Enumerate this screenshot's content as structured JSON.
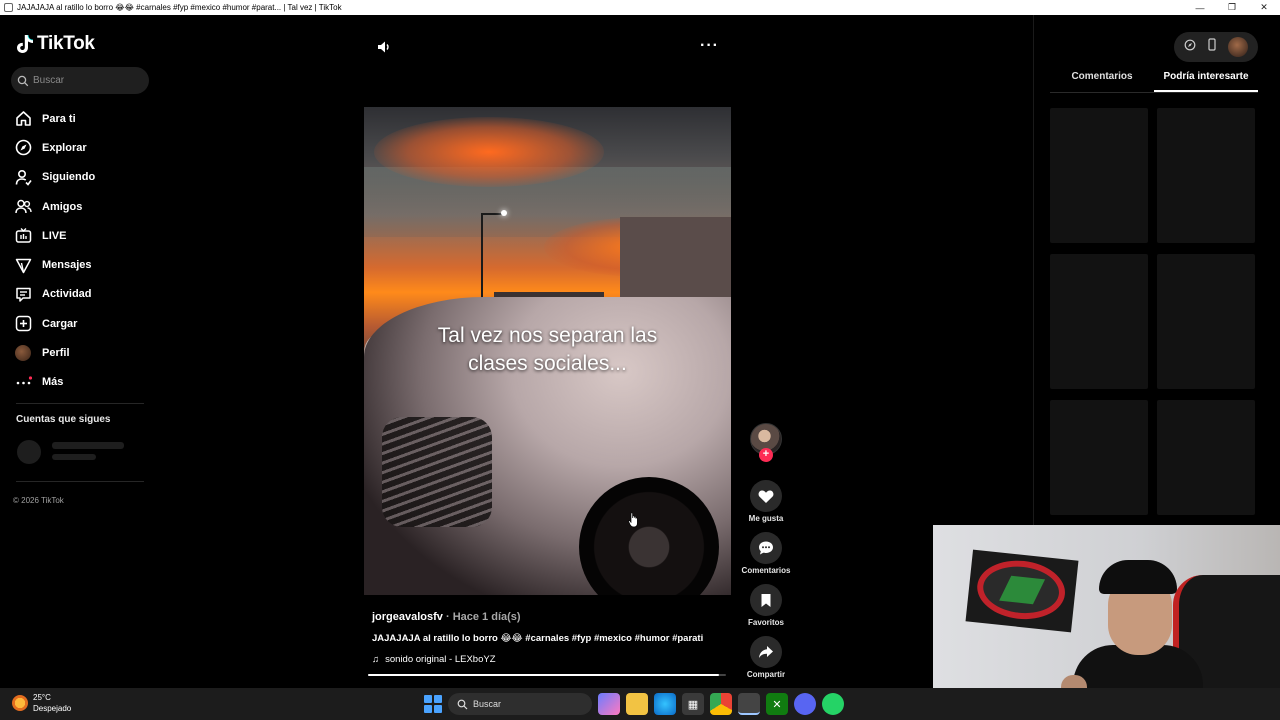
{
  "window": {
    "title": "JAJAJAJA al ratillo lo borro 😂😂 #carnales #fyp #mexico #humor #parat... | Tal vez | TikTok"
  },
  "sidebar": {
    "logo": "TikTok",
    "search_placeholder": "Buscar",
    "items": [
      {
        "label": "Para ti",
        "icon": "home-icon"
      },
      {
        "label": "Explorar",
        "icon": "compass-icon"
      },
      {
        "label": "Siguiendo",
        "icon": "user-follow-icon"
      },
      {
        "label": "Amigos",
        "icon": "friends-icon"
      },
      {
        "label": "LIVE",
        "icon": "live-tv-icon"
      },
      {
        "label": "Mensajes",
        "icon": "send-icon"
      },
      {
        "label": "Actividad",
        "icon": "activity-icon"
      },
      {
        "label": "Cargar",
        "icon": "upload-plus-icon"
      },
      {
        "label": "Perfil",
        "icon": "avatar-icon"
      },
      {
        "label": "Más",
        "icon": "more-dots-icon"
      }
    ],
    "following_title": "Cuentas que sigues",
    "copyright": "© 2026 TikTok"
  },
  "video": {
    "caption_line1": "Tal vez nos separan las",
    "caption_line2": "clases sociales...",
    "username": "jorgeavalosfv",
    "time_ago": "· Hace 1 día(s)",
    "description": "JAJAJAJA al ratillo lo borro 😂😂 #carnales #fyp #mexico #humor #parati",
    "sound": "sonido original - LEXboYZ",
    "progress": 0.98
  },
  "actions": {
    "like": "Me gusta",
    "comments": "Comentarios",
    "favorites": "Favoritos",
    "share": "Compartir"
  },
  "right_panel": {
    "tabs": [
      {
        "label": "Comentarios",
        "active": false
      },
      {
        "label": "Podría interesarte",
        "active": true
      }
    ]
  },
  "taskbar": {
    "temp": "25°C",
    "weather": "Despejado",
    "search": "Buscar"
  },
  "colors": {
    "accent": "#fe2c55",
    "background": "#000000"
  }
}
